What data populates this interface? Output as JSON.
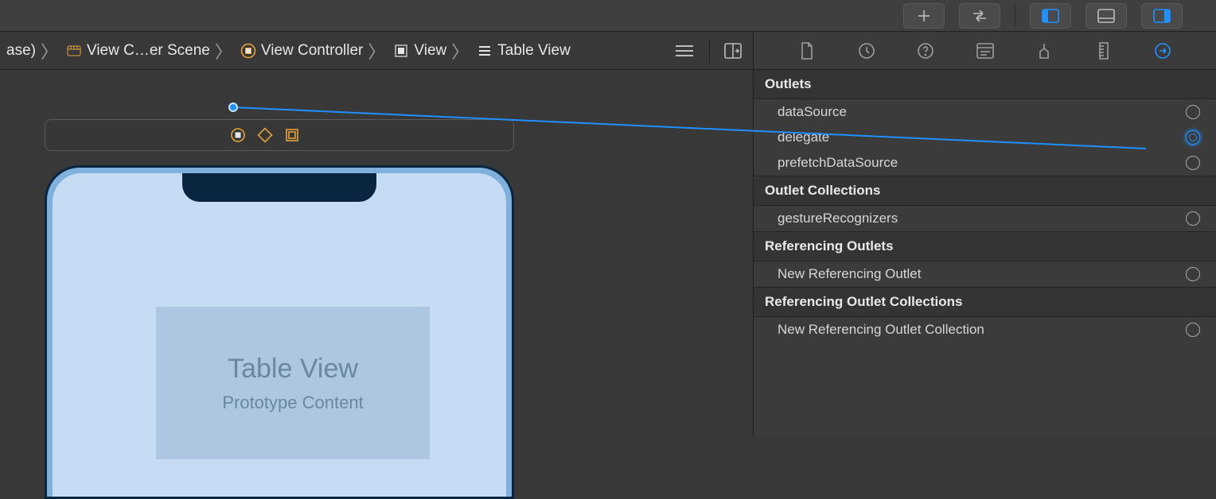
{
  "breadcrumb": {
    "first": "ase)",
    "scene": "View C…er Scene",
    "vc": "View Controller",
    "view": "View",
    "table": "Table View"
  },
  "scene": {
    "tv_title": "Table View",
    "tv_sub": "Prototype Content"
  },
  "inspector": {
    "sections": {
      "outlets": "Outlets",
      "outlet_collections": "Outlet Collections",
      "ref_outlets": "Referencing Outlets",
      "ref_outlet_collections": "Referencing Outlet Collections"
    },
    "rows": {
      "dataSource": "dataSource",
      "delegate": "delegate",
      "prefetch": "prefetchDataSource",
      "gesture": "gestureRecognizers",
      "new_ref": "New Referencing Outlet",
      "new_ref_coll": "New Referencing Outlet Collection"
    }
  }
}
